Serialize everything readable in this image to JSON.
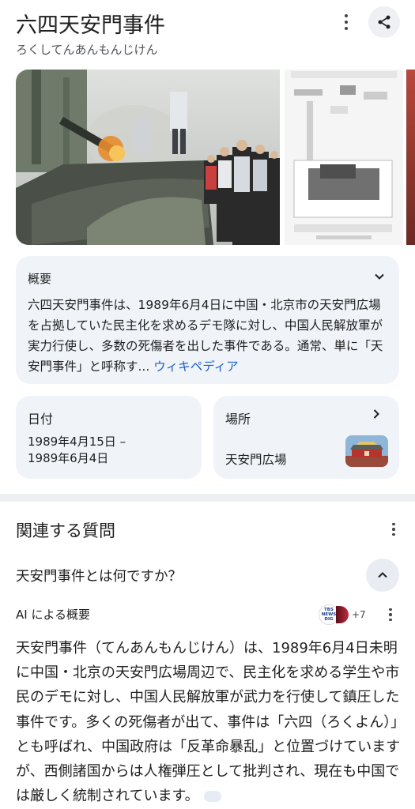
{
  "header": {
    "title": "六四天安門事件",
    "reading": "ろくしてんあんもんじけん"
  },
  "overview": {
    "heading": "概要",
    "body": "六四天安門事件は、1989年6月4日に中国・北京市の天安門広場を占拠していた民主化を求めるデモ隊に対し、中国人民解放軍が実力行使し、多数の死傷者を出した事件である。通常、単に「天安門事件」と呼称す...",
    "source_link": "ウィキペディア"
  },
  "facts": {
    "date_label": "日付",
    "date_value": "1989年4月15日 –\n1989年6月4日",
    "place_label": "場所",
    "place_value": "天安門広場"
  },
  "related": {
    "heading": "関連する質問",
    "question": "天安門事件とは何ですか？",
    "ai_label": "AI による概要",
    "source_badge_text": "TBS NEWS DIG",
    "more_sources": "+7",
    "answer": "天安門事件（てんあんもんじけん）は、1989年6月4日未明に中国・北京の天安門広場周辺で、民主化を求める学生や市民のデモに対し、中国人民解放軍が武力を行使して鎮圧した事件です。多くの死傷者が出て、事件は「六四（ろくよん）」とも呼ばれ、中国政府は「反革命暴乱」と位置づけていますが、西側諸国からは人権弾圧として批判され、現在も中国では厳しく統制されています。"
  },
  "colors": {
    "link": "#1a5dc9",
    "card_bg": "#f0f4f9"
  }
}
